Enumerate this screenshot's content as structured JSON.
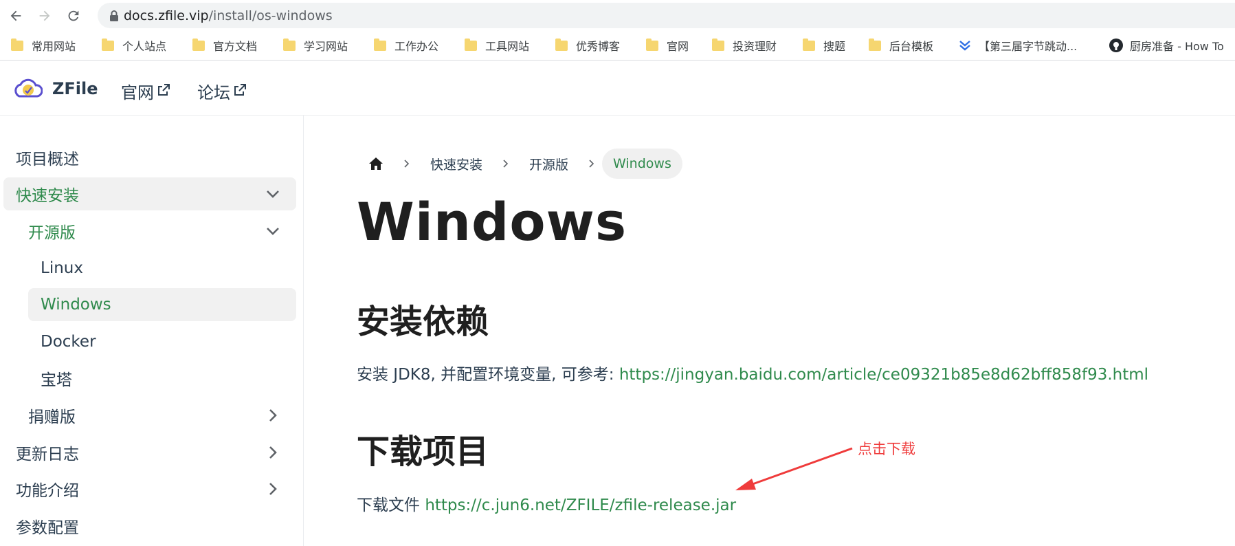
{
  "browser": {
    "url_host": "docs.zfile.vip",
    "url_path": "/install/os-windows",
    "bookmarks": [
      "常用网站",
      "个人站点",
      "官方文档",
      "学习网站",
      "工作办公",
      "工具网站",
      "优秀博客",
      "官网",
      "投资理财",
      "搜题",
      "后台模板",
      "【第三届字节跳动...",
      "厨房准备 - How To"
    ]
  },
  "header": {
    "brand": "ZFile",
    "nav": [
      "官网",
      "论坛"
    ]
  },
  "sidebar": {
    "items": [
      {
        "label": "项目概述"
      },
      {
        "label": "快速安装"
      },
      {
        "label": "开源版"
      },
      {
        "label": "Linux"
      },
      {
        "label": "Windows"
      },
      {
        "label": "Docker"
      },
      {
        "label": "宝塔"
      },
      {
        "label": "捐赠版"
      },
      {
        "label": "更新日志"
      },
      {
        "label": "功能介绍"
      },
      {
        "label": "参数配置"
      }
    ]
  },
  "breadcrumb": [
    "快速安装",
    "开源版",
    "Windows"
  ],
  "content": {
    "title": "Windows",
    "section1": {
      "heading": "安装依赖",
      "text": "安装 JDK8, 并配置环境变量, 可参考: ",
      "link": "https://jingyan.baidu.com/article/ce09321b85e8d62bff858f93.html"
    },
    "section2": {
      "heading": "下载项目",
      "text": "下载文件 ",
      "link": "https://c.jun6.net/ZFILE/zfile-release.jar"
    },
    "annotation": "点击下载"
  },
  "colors": {
    "accent_green": "#2f8a4c",
    "annotation_red": "#ef3b3b",
    "folder_yellow": "#f6d670"
  }
}
